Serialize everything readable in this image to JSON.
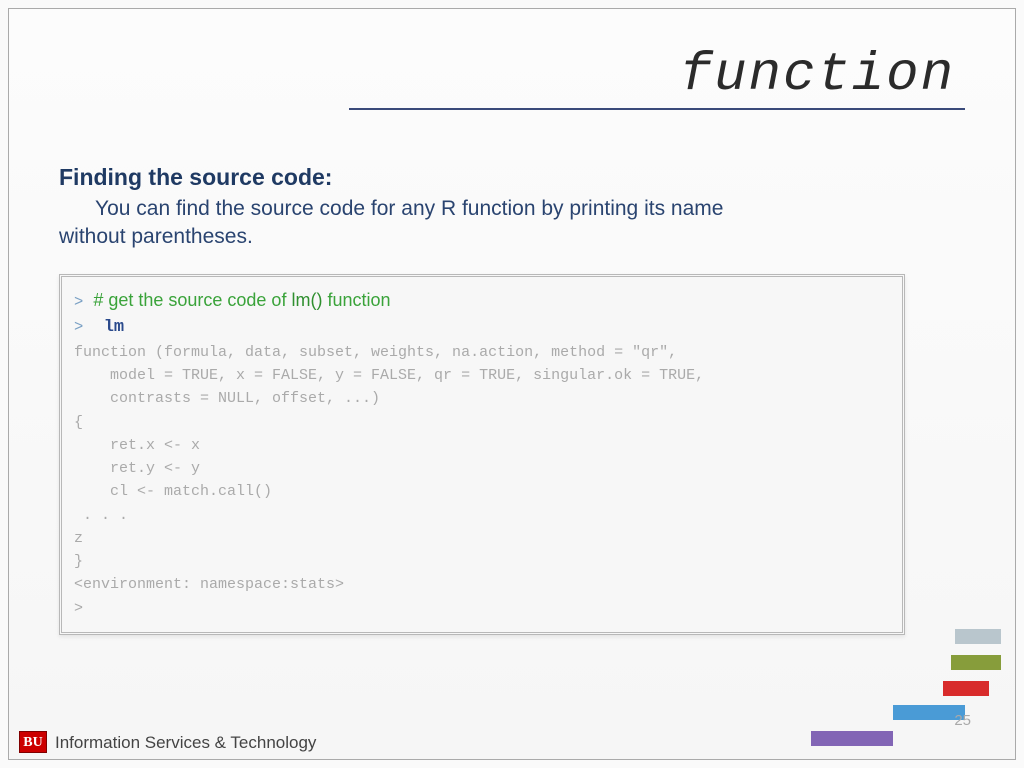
{
  "title": "function",
  "heading": "Finding the source code:",
  "desc_line1": "You can find the source code for any R function by printing its name",
  "desc_line2": "without parentheses.",
  "code": {
    "prompt1": ">",
    "comment_pre": "  # get the source code of ",
    "comment_fn": "lm()",
    "comment_post": " function",
    "prompt2": ">",
    "lm": "  lm",
    "l1": "function (formula, data, subset, weights, na.action, method = \"qr\", ",
    "l2": "    model = TRUE, x = FALSE, y = FALSE, qr = TRUE, singular.ok = TRUE, ",
    "l3": "    contrasts = NULL, offset, ...) ",
    "l4": "{",
    "l5": "    ret.x <- x",
    "l6": "    ret.y <- y",
    "l7": "    cl <- match.call()",
    "l8": "",
    "l9": " . . .",
    "l10": "z",
    "l11": "}",
    "l12": "<environment: namespace:stats>",
    "l13": ">"
  },
  "footer": {
    "badge": "BU",
    "text": "Information Services & Technology",
    "page": "25"
  }
}
